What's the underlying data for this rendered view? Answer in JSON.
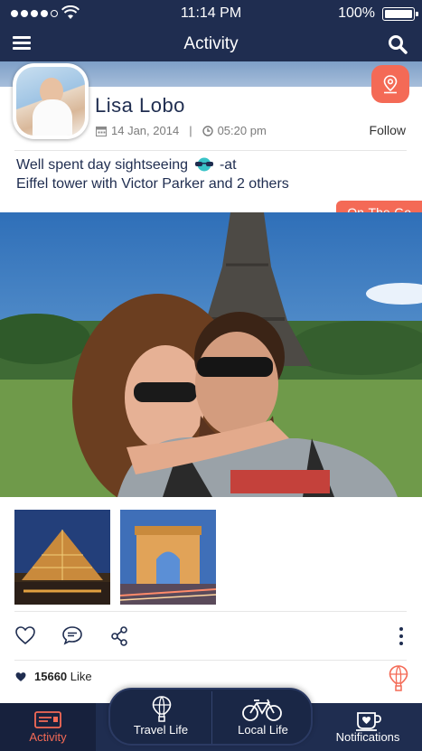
{
  "status_bar": {
    "time": "11:14 PM",
    "battery": "100%"
  },
  "header": {
    "title": "Activity",
    "menu_icon": "menu-icon",
    "search_icon": "search-icon"
  },
  "post": {
    "user_name": "Lisa Lobo",
    "date": "14 Jan, 2014",
    "time": "05:20 pm",
    "follow_label": "Follow",
    "text_line1": "Well spent day sightseeing",
    "text_line1_suffix": "-at",
    "text_line2": "Eiffel tower with Victor Parker and 2 others",
    "tag": "On-The-Go",
    "likes_count": "15660",
    "likes_label": "Like"
  },
  "nav": {
    "activity": "Activity",
    "travel_life": "Travel Life",
    "local_life": "Local Life",
    "notifications": "Notifications"
  },
  "colors": {
    "navy": "#1f2d50",
    "accent": "#f46a56"
  }
}
